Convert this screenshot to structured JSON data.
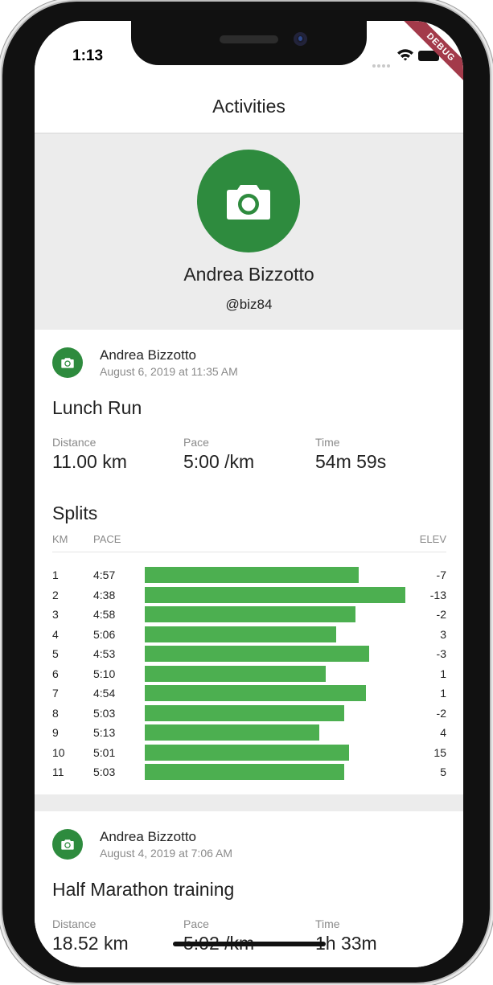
{
  "status_bar": {
    "time": "1:13"
  },
  "debug_banner": "DEBUG",
  "app_bar": {
    "title": "Activities"
  },
  "profile": {
    "name": "Andrea Bizzotto",
    "handle": "@biz84"
  },
  "stat_labels": {
    "distance": "Distance",
    "pace": "Pace",
    "time": "Time"
  },
  "activities": [
    {
      "user": "Andrea Bizzotto",
      "date": "August 6, 2019 at 11:35 AM",
      "title": "Lunch Run",
      "distance": "11.00 km",
      "pace": "5:00 /km",
      "time": "54m 59s",
      "splits_title": "Splits",
      "splits_headers": {
        "km": "KM",
        "pace": "PACE",
        "elev": "ELEV"
      },
      "splits": [
        {
          "km": "1",
          "pace": "4:57",
          "elev": "-7",
          "bar_fraction": 0.82
        },
        {
          "km": "2",
          "pace": "4:38",
          "elev": "-13",
          "bar_fraction": 1.0
        },
        {
          "km": "3",
          "pace": "4:58",
          "elev": "-2",
          "bar_fraction": 0.81
        },
        {
          "km": "4",
          "pace": "5:06",
          "elev": "3",
          "bar_fraction": 0.735
        },
        {
          "km": "5",
          "pace": "4:53",
          "elev": "-3",
          "bar_fraction": 0.86
        },
        {
          "km": "6",
          "pace": "5:10",
          "elev": "1",
          "bar_fraction": 0.695
        },
        {
          "km": "7",
          "pace": "4:54",
          "elev": "1",
          "bar_fraction": 0.85
        },
        {
          "km": "8",
          "pace": "5:03",
          "elev": "-2",
          "bar_fraction": 0.765
        },
        {
          "km": "9",
          "pace": "5:13",
          "elev": "4",
          "bar_fraction": 0.67
        },
        {
          "km": "10",
          "pace": "5:01",
          "elev": "15",
          "bar_fraction": 0.785
        },
        {
          "km": "11",
          "pace": "5:03",
          "elev": "5",
          "bar_fraction": 0.765
        }
      ]
    },
    {
      "user": "Andrea Bizzotto",
      "date": "August 4, 2019 at 7:06 AM",
      "title": "Half Marathon training",
      "distance": "18.52 km",
      "pace": "5:02 /km",
      "time": "1h 33m"
    }
  ],
  "colors": {
    "accent_green": "#2e8b3e",
    "bar_green": "#4caf50",
    "debug_red": "#a33a4a"
  }
}
